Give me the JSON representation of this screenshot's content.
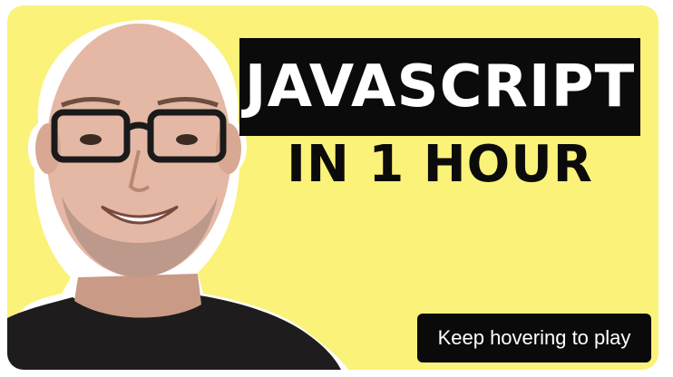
{
  "thumbnail": {
    "title": "JAVASCRIPT",
    "subtitle": "IN 1 HOUR",
    "background_color": "#fbf27a",
    "title_box_color": "#0b0b0b"
  },
  "overlay": {
    "hover_label": "Keep hovering to play"
  },
  "person": {
    "icon": "instructor-photo"
  }
}
